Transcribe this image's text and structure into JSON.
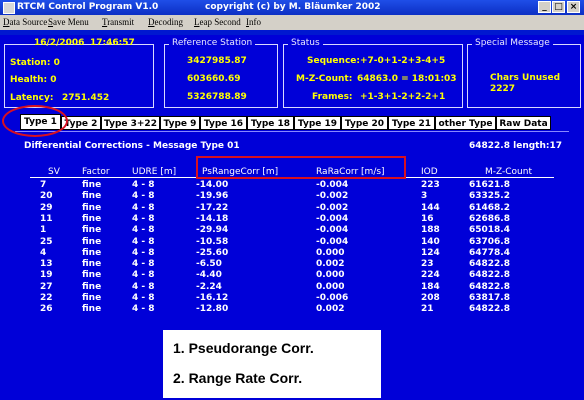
{
  "window": {
    "title": "RTCM Control Program V1.0",
    "copyright": "copyright (c) by M. Bläumker 2002",
    "minimize": "_",
    "maximize": "□",
    "close": "×"
  },
  "menu": [
    "Data Source",
    "Save Menu",
    "Transmit",
    "Decoding",
    "Leap Second",
    "Info"
  ],
  "status_left": {
    "date": "16/2/2006",
    "time": "17:46:57",
    "station": "Station: 0",
    "health": "Health: 0",
    "latency_label": "Latency:",
    "latency_value": "2751.452"
  },
  "reference_station": {
    "label": "Reference Station",
    "x": "3427985.87",
    "y": "603660.69",
    "z": "5326788.89"
  },
  "status": {
    "label": "Status",
    "sequence_label": "Sequence:",
    "sequence_value": "+7-0+1-2+3-4+5",
    "mz_label": "M-Z-Count:",
    "mz_value": "64863.0 = 18:01:03",
    "frames_label": "Frames:",
    "frames_value": "+1-3+1-2+2-2+1"
  },
  "special_message": {
    "label": "Special Message",
    "line1": "Chars Unused",
    "line2": "2227"
  },
  "tabs": [
    "Type 1",
    "Type 2",
    "Type 3+22",
    "Type 9",
    "Type 16",
    "Type 18",
    "Type 19",
    "Type 20",
    "Type 21",
    "other Type",
    "Raw Data"
  ],
  "panel": {
    "title": "Differential Corrections - Message Type 01",
    "summary": "64822.8 length:17"
  },
  "table": {
    "headers": [
      "SV",
      "Factor",
      "UDRE [m]",
      "PsRangeCorr [m]",
      "RaRaCorr [m/s]",
      "IOD",
      "M-Z-Count"
    ],
    "rows": [
      [
        "7",
        "fine",
        "4 - 8",
        "-14.00",
        "-0.004",
        "223",
        "61621.8"
      ],
      [
        "20",
        "fine",
        "4 - 8",
        "-19.96",
        "-0.002",
        "3",
        "63325.2"
      ],
      [
        "29",
        "fine",
        "4 - 8",
        "-17.22",
        "-0.002",
        "144",
        "61468.2"
      ],
      [
        "11",
        "fine",
        "4 - 8",
        "-14.18",
        "-0.004",
        "16",
        "62686.8"
      ],
      [
        "1",
        "fine",
        "4 - 8",
        "-29.94",
        "-0.004",
        "188",
        "65018.4"
      ],
      [
        "25",
        "fine",
        "4 - 8",
        "-10.58",
        "-0.004",
        "140",
        "63706.8"
      ],
      [
        "4",
        "fine",
        "4 - 8",
        "-25.60",
        "0.000",
        "124",
        "64778.4"
      ],
      [
        "13",
        "fine",
        "4 - 8",
        "-6.50",
        "0.002",
        "23",
        "64822.8"
      ],
      [
        "19",
        "fine",
        "4 - 8",
        "-4.40",
        "0.000",
        "224",
        "64822.8"
      ],
      [
        "27",
        "fine",
        "4 - 8",
        "-2.24",
        "0.000",
        "184",
        "64822.8"
      ],
      [
        "22",
        "fine",
        "4 - 8",
        "-16.12",
        "-0.006",
        "208",
        "63817.8"
      ],
      [
        "26",
        "fine",
        "4 - 8",
        "-12.80",
        "0.002",
        "21",
        "64822.8"
      ]
    ]
  },
  "annotation": {
    "line1": "1. Pseudorange Corr.",
    "line2": "2. Range Rate Corr."
  },
  "colors": {
    "background": "#0000d8",
    "highlight_text": "#ffff00",
    "annotation_red": "#d81020",
    "tab_face": "#ffffff"
  }
}
